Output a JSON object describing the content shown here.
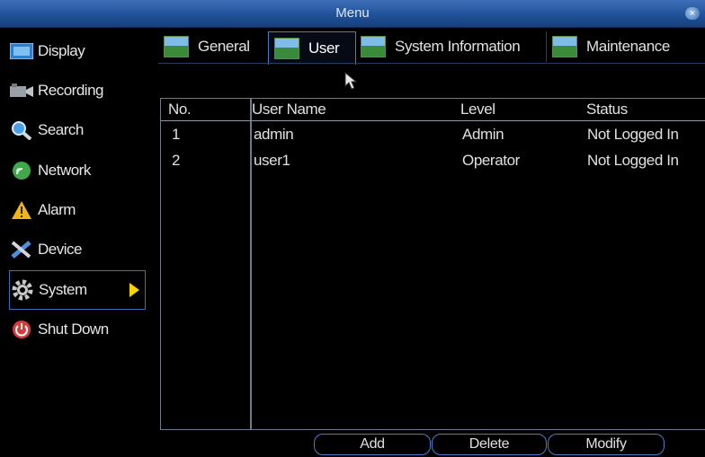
{
  "window": {
    "title": "Menu",
    "close_label": "×"
  },
  "sidebar": {
    "items": [
      {
        "label": "Display",
        "icon": "display-icon"
      },
      {
        "label": "Recording",
        "icon": "recording-icon"
      },
      {
        "label": "Search",
        "icon": "search-icon"
      },
      {
        "label": "Network",
        "icon": "network-icon"
      },
      {
        "label": "Alarm",
        "icon": "alarm-icon"
      },
      {
        "label": "Device",
        "icon": "device-icon"
      },
      {
        "label": "System",
        "icon": "gear-icon",
        "active": true
      },
      {
        "label": "Shut Down",
        "icon": "power-icon"
      }
    ]
  },
  "tabs": [
    {
      "label": "General"
    },
    {
      "label": "User",
      "active": true
    },
    {
      "label": "System Information"
    },
    {
      "label": "Maintenance"
    }
  ],
  "table": {
    "headers": [
      "No.",
      "User Name",
      "Level",
      "Status"
    ],
    "rows": [
      [
        "1",
        "admin",
        "Admin",
        "Not Logged In"
      ],
      [
        "2",
        "user1",
        "Operator",
        "Not Logged In"
      ]
    ]
  },
  "buttons": {
    "add": "Add",
    "delete": "Delete",
    "modify": "Modify"
  },
  "colors": {
    "accent": "#3b6fb8",
    "title_bar": "#2a5ba4",
    "arrow": "#f5d400"
  }
}
